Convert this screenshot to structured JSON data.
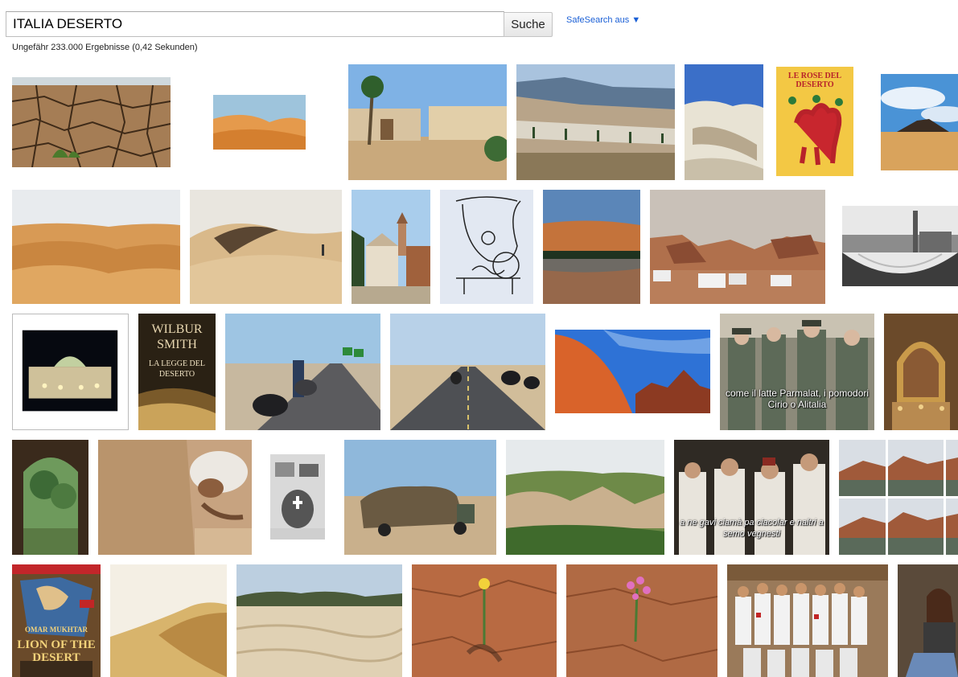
{
  "search": {
    "query": "ITALIA DESERTO",
    "button_label": "Suche",
    "safesearch_label": "SafeSearch aus",
    "safesearch_arrow": "▼",
    "stats": "Ungefähr 233.000 Ergebnisse (0,42 Sekunden)"
  },
  "thumb_text": {
    "rose_poster_title": "LE ROSE DEL DESERTO",
    "wilbur_author": "WILBUR SMITH",
    "wilbur_title": "LA LEGGE DEL DESERTO",
    "parmalat_caption": "come il latte Parmalat, i pomodori Cirio o Alitalia",
    "vegnesti_caption": "a ne gavi ciamà pa ciacolar e naltri a semo vegnesti",
    "lion_title": "LION OF THE DESERT",
    "lion_actor": "OMAR MUKHTAR"
  }
}
